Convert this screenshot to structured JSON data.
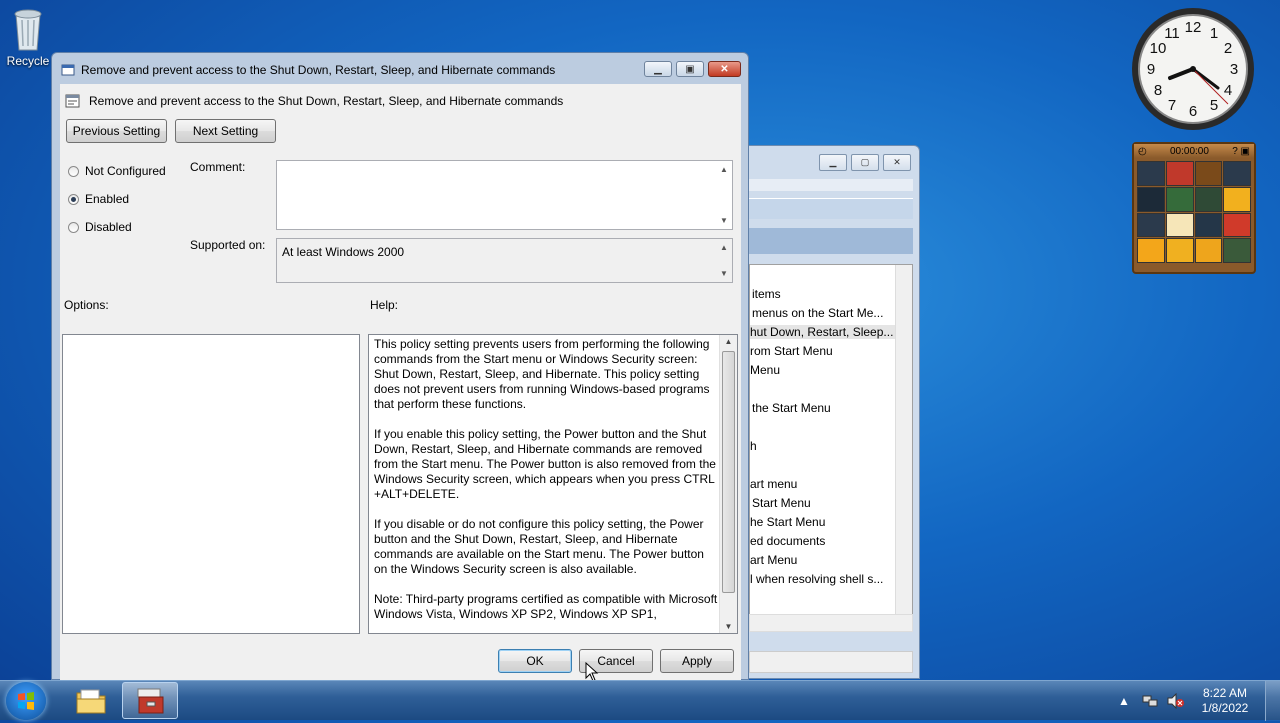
{
  "desktop": {
    "recycle_label": "Recycle"
  },
  "clock_gadget": {
    "time": "8:22"
  },
  "puzzle_gadget": {
    "timer": "00:00:00"
  },
  "bg_window": {
    "items": [
      "items",
      "menus on the Start Me...",
      "hut Down, Restart, Sleep...",
      "rom Start Menu",
      "Menu",
      "",
      "the Start Menu",
      "",
      "h",
      "",
      "art menu",
      "Start Menu",
      "he Start Menu",
      "ed documents",
      "art Menu",
      "l when resolving shell s..."
    ]
  },
  "dialog": {
    "title": "Remove and prevent access to the Shut Down, Restart, Sleep, and Hibernate commands",
    "header": "Remove and prevent access to the Shut Down, Restart, Sleep, and Hibernate commands",
    "prev_label": "Previous Setting",
    "next_label": "Next Setting",
    "radio": {
      "not_configured": "Not Configured",
      "enabled": "Enabled",
      "disabled": "Disabled",
      "selected": "enabled"
    },
    "comment_label": "Comment:",
    "comment_value": "",
    "supported_label": "Supported on:",
    "supported_value": "At least Windows 2000",
    "options_label": "Options:",
    "help_label": "Help:",
    "help": [
      "This policy setting prevents users from performing the following commands from the Start menu or Windows Security screen: Shut Down, Restart, Sleep, and Hibernate. This policy setting does not prevent users from running Windows-based programs that perform these functions.",
      "If you enable this policy setting, the Power button and the Shut Down, Restart, Sleep, and Hibernate commands are removed from the Start menu. The Power button is also removed from the Windows Security screen, which appears when you press CTRL +ALT+DELETE.",
      "If you disable or do not configure this policy setting, the Power button and the Shut Down, Restart, Sleep, and Hibernate commands are available on the Start menu. The Power button on the Windows Security screen is also available.",
      "Note: Third-party programs certified as compatible with Microsoft Windows Vista, Windows XP SP2, Windows XP SP1,"
    ],
    "ok_label": "OK",
    "cancel_label": "Cancel",
    "apply_label": "Apply"
  },
  "taskbar": {
    "time": "8:22 AM",
    "date": "1/8/2022"
  },
  "colors": {
    "desktop": "#1266c2",
    "dialog_frame": "#bccce0",
    "close_button": "#c23a22"
  }
}
